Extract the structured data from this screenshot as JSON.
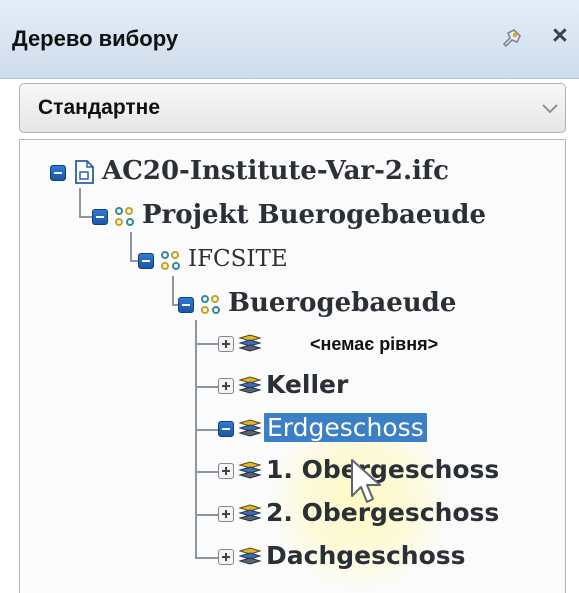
{
  "panel": {
    "title": "Дерево вибору",
    "close_glyph": "×",
    "pin_icon": "pin-icon"
  },
  "dropdown": {
    "selected": "Стандартне",
    "icon": "chevron-down-icon"
  },
  "tree": {
    "root": {
      "label": "AC20-Institute-Var-2.ifc",
      "icon": "file-icon",
      "expanded": true
    },
    "project": {
      "label": "Projekt Buerogebaeude",
      "icon": "hierarchy-icon",
      "expanded": true
    },
    "site": {
      "label": "IFCSITE",
      "icon": "hierarchy-icon",
      "expanded": true
    },
    "building": {
      "label": "Buerogebaeude",
      "icon": "hierarchy-icon",
      "expanded": true
    },
    "levels": [
      {
        "label": "<немає рівня>",
        "icon": "layers-icon",
        "expanded": false,
        "selected": false
      },
      {
        "label": "Keller",
        "icon": "layers-icon",
        "expanded": false,
        "selected": false
      },
      {
        "label": "Erdgeschoss",
        "icon": "layers-icon",
        "expanded": false,
        "selected": true
      },
      {
        "label": "1. Obergeschoss",
        "icon": "layers-icon",
        "expanded": false,
        "selected": false
      },
      {
        "label": "2. Obergeschoss",
        "icon": "layers-icon",
        "expanded": false,
        "selected": false
      },
      {
        "label": "Dachgeschoss",
        "icon": "layers-icon",
        "expanded": false,
        "selected": false
      }
    ]
  },
  "colors": {
    "selection": "#3b7fc6",
    "toggle_expanded": "#1b57a8",
    "layer_yellow": "#e0b62a",
    "layer_blue": "#3d6fb5"
  }
}
